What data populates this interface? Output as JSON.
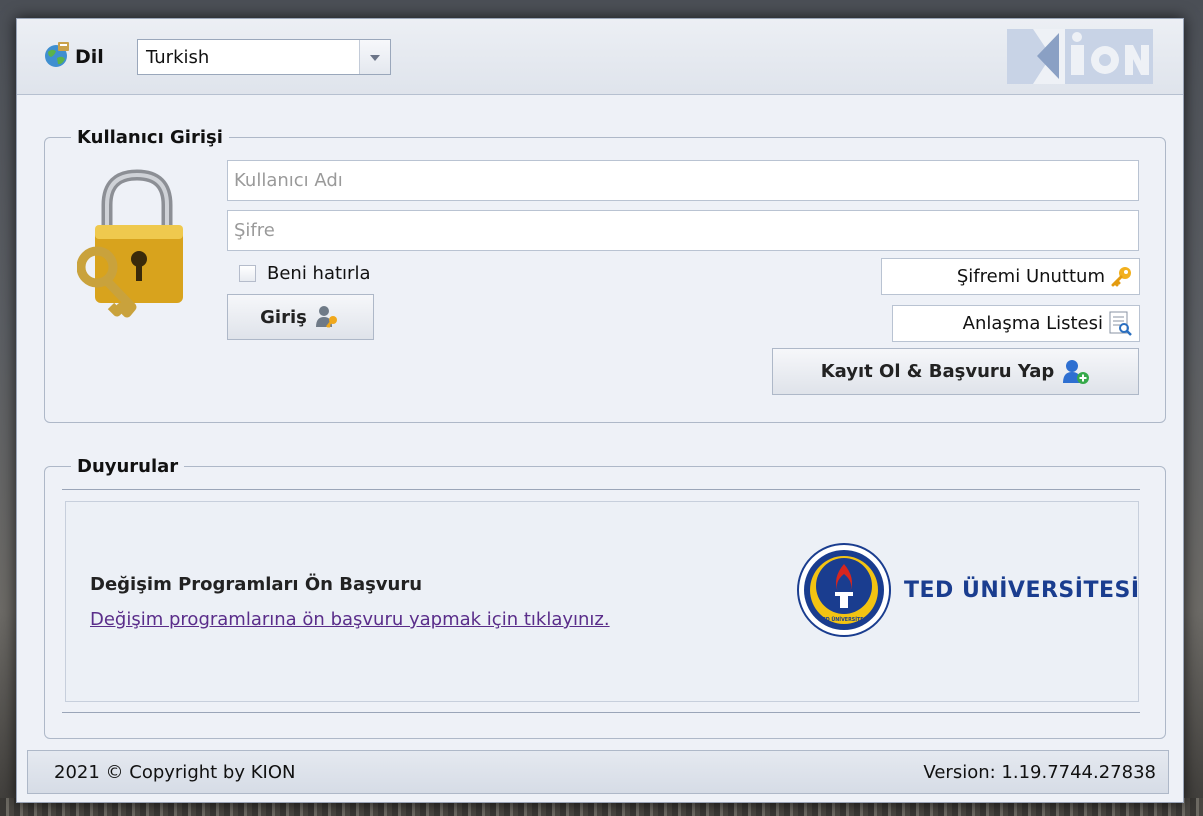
{
  "language": {
    "label": "Dil",
    "selected": "Turkish"
  },
  "brand": {
    "logo_text": "KION"
  },
  "login": {
    "legend": "Kullanıcı Girişi",
    "username_placeholder": "Kullanıcı Adı",
    "password_placeholder": "Şifre",
    "remember_label": "Beni hatırla",
    "remember_checked": false,
    "login_button": "Giriş",
    "forgot_password": "Şifremi Unuttum",
    "agreement_list": "Anlaşma Listesi",
    "register_button": "Kayıt Ol & Başvuru Yap"
  },
  "announcements": {
    "legend": "Duyurular",
    "items": [
      {
        "title": "Değişim Programları Ön Başvuru",
        "link_text": "Değişim programlarına ön başvuru yapmak için tıklayınız.",
        "institution": "TED ÜNİVERSİTESİ",
        "seal_caption": "TED ÜNİVERSİTESİ"
      }
    ]
  },
  "footer": {
    "copyright": "2021 © Copyright by KION",
    "version": "Version: 1.19.7744.27838"
  },
  "colors": {
    "link": "#5a2d8a",
    "ted_blue": "#1a3d8f",
    "kion_blue": "#7f93b8"
  },
  "icons": [
    "globe-icon",
    "chevron-down-icon",
    "lock-key-icon",
    "user-key-icon",
    "key-icon",
    "list-search-icon",
    "user-add-icon"
  ]
}
